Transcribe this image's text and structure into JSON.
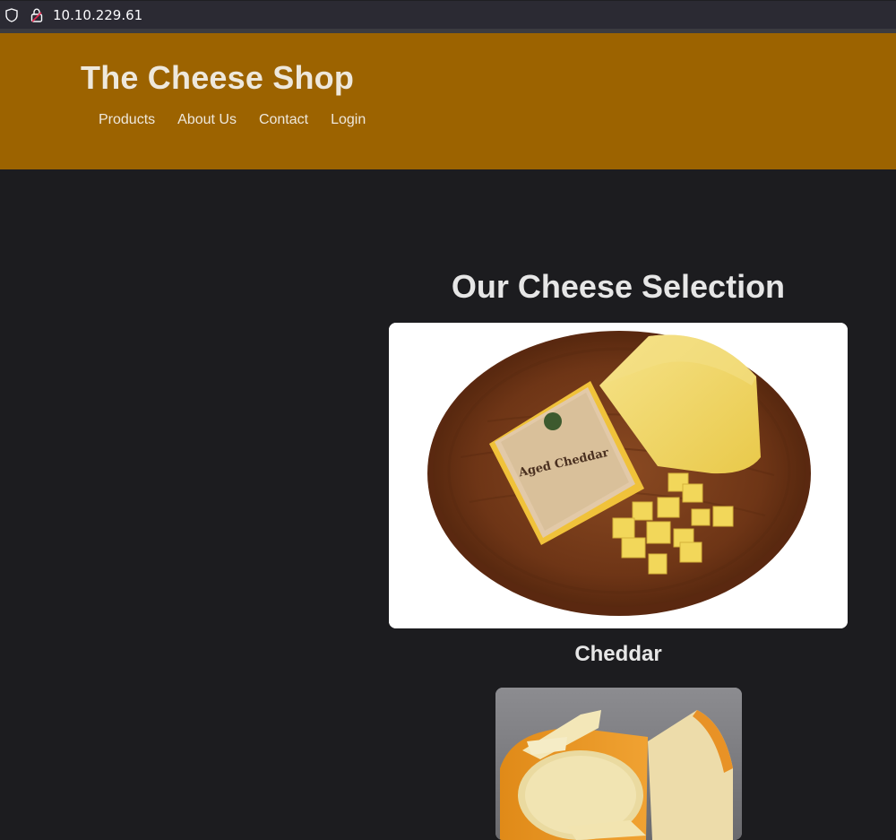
{
  "browser": {
    "url": "10.10.229.61"
  },
  "site": {
    "title": "The Cheese Shop",
    "nav": [
      "Products",
      "About Us",
      "Contact",
      "Login"
    ]
  },
  "main": {
    "section_title": "Our Cheese Selection",
    "products": [
      {
        "name": "Cheddar",
        "image": "aged-cheddar-photo",
        "package_label": "Aged Cheddar"
      },
      {
        "name": "",
        "image": "gouda-wheel-photo"
      }
    ]
  },
  "colors": {
    "header_bg": "#9c6300",
    "page_bg": "#1c1c1f",
    "text": "#e6e6e6"
  }
}
